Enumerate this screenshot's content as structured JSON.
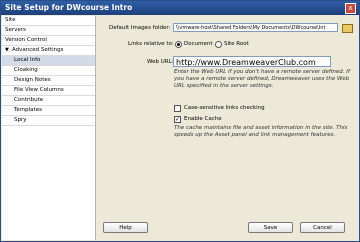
{
  "window": {
    "title": "Site Setup for DWcourse Intro",
    "close_glyph": "x"
  },
  "sidebar": {
    "items": [
      {
        "label": "Site",
        "selected": false
      },
      {
        "label": "Servers",
        "selected": false
      },
      {
        "label": "Version Control",
        "selected": false
      },
      {
        "label": "Advanced Settings",
        "selected": false,
        "expanded": true
      },
      {
        "label": "Local Info",
        "selected": true
      },
      {
        "label": "Cloaking",
        "selected": false
      },
      {
        "label": "Design Notes",
        "selected": false
      },
      {
        "label": "File View Columns",
        "selected": false
      },
      {
        "label": "Contribute",
        "selected": false
      },
      {
        "label": "Templates",
        "selected": false
      },
      {
        "label": "Spry",
        "selected": false
      }
    ],
    "expand_glyph": "▼"
  },
  "main": {
    "images_label": "Default Images folder:",
    "images_value": "\\\\vmware-host\\Shared Folders\\My Documents\\DWcourse\\Int",
    "links_label": "Links relative to:",
    "link_options": [
      "Document",
      "Site Root"
    ],
    "selected_link_option": "Document",
    "weburl_label": "Web URL:",
    "weburl_value": "http://www.DreamweaverClub.com",
    "weburl_note": [
      "Enter the Web URL if you don't have a remote server defined. If",
      "you have a remote server defined, Dreamweaver uses the Web",
      "URL specified in the server settings."
    ],
    "case_label": "Case-sensitive links checking",
    "case_checked": false,
    "cache_label": "Enable Cache",
    "cache_checked": true,
    "cache_note": [
      "The cache maintains file and asset information in the site. This",
      "speeds up the Asset panel and link management features."
    ],
    "check_glyph": "✓"
  },
  "buttons": {
    "help": "Help",
    "save": "Save",
    "cancel": "Cancel"
  }
}
